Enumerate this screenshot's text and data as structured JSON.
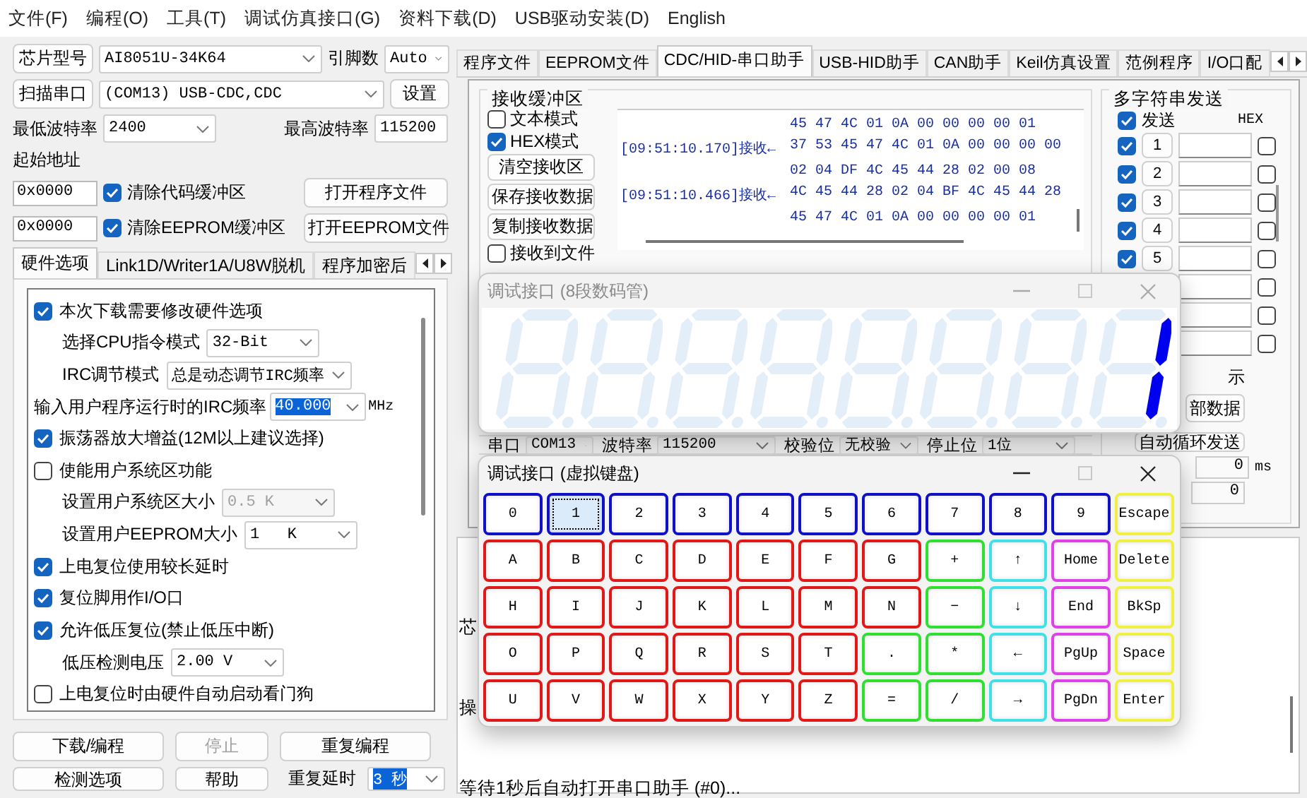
{
  "menu": [
    "文件(F)",
    "编程(O)",
    "工具(T)",
    "调试仿真接口(G)",
    "资料下载(D)",
    "USB驱动安装(D)",
    "English"
  ],
  "left": {
    "chip": {
      "button": "芯片型号",
      "value": "AI8051U-34K64",
      "pins_label": "引脚数",
      "pins": "Auto"
    },
    "port": {
      "button": "扫描串口",
      "value": "(COM13) USB-CDC,CDC",
      "settings": "设置"
    },
    "baud": {
      "min_label": "最低波特率",
      "min": "2400",
      "max_label": "最高波特率",
      "max": "115200"
    },
    "start_address_label": "起始地址",
    "buffers": [
      {
        "address": "0x0000",
        "label": "清除代码缓冲区",
        "checked": true,
        "button": "打开程序文件"
      },
      {
        "address": "0x0000",
        "label": "清除EEPROM缓冲区",
        "checked": true,
        "button": "打开EEPROM文件"
      }
    ],
    "tabs": [
      {
        "label": "硬件选项",
        "selected": true
      },
      {
        "label": "Link1D/Writer1A/U8W脱机",
        "selected": false
      },
      {
        "label": "程序加密后",
        "selected": false
      }
    ],
    "options": [
      {
        "kind": "checkbox",
        "label": "本次下载需要修改硬件选项",
        "checked": true
      },
      {
        "kind": "sub-select",
        "label": "选择CPU指令模式",
        "value": "32-Bit",
        "disabled": false
      },
      {
        "kind": "sub-select",
        "label": "IRC调节模式",
        "value": "总是动态调节IRC频率",
        "disabled": false
      },
      {
        "kind": "input-select",
        "label": "输入用户程序运行时的IRC频率",
        "value": "40.000",
        "unit": "MHz"
      },
      {
        "kind": "checkbox",
        "label": "振荡器放大增益(12M以上建议选择)",
        "checked": true
      },
      {
        "kind": "checkbox",
        "label": "使能用户系统区功能",
        "checked": false
      },
      {
        "kind": "sub-select",
        "label": "设置用户系统区大小",
        "value": "0.5 K",
        "disabled": true
      },
      {
        "kind": "sub-select",
        "label": "设置用户EEPROM大小",
        "value": "1   K",
        "disabled": false
      },
      {
        "kind": "checkbox",
        "label": "上电复位使用较长延时",
        "checked": true
      },
      {
        "kind": "checkbox",
        "label": "复位脚用作I/O口",
        "checked": true
      },
      {
        "kind": "checkbox",
        "label": "允许低压复位(禁止低压中断)",
        "checked": true
      },
      {
        "kind": "sub-select",
        "label": "低压检测电压",
        "value": "2.00 V",
        "disabled": false
      },
      {
        "kind": "checkbox",
        "label": "上电复位时由硬件自动启动看门狗",
        "checked": false
      }
    ],
    "actions": [
      {
        "label": "下载/编程",
        "disabled": false
      },
      {
        "label": "停止",
        "disabled": true
      },
      {
        "label": "重复编程",
        "disabled": false
      }
    ],
    "check_options": "检测选项",
    "help": "帮助",
    "repeat_delay_label": "重复延时",
    "repeat_delay": "3 秒"
  },
  "right": {
    "tabs": [
      {
        "label": "程序文件",
        "selected": false
      },
      {
        "label": "EEPROM文件",
        "selected": false
      },
      {
        "label": "CDC/HID-串口助手",
        "selected": true
      },
      {
        "label": "USB-HID助手",
        "selected": false
      },
      {
        "label": "CAN助手",
        "selected": false
      },
      {
        "label": "Keil仿真设置",
        "selected": false
      },
      {
        "label": "范例程序",
        "selected": false
      },
      {
        "label": "I/O口配",
        "selected": false
      }
    ],
    "receive": {
      "title": "接收缓冲区",
      "modes": [
        {
          "label": "文本模式",
          "checked": false
        },
        {
          "label": "HEX模式",
          "checked": true
        }
      ],
      "buttons": [
        "清空接收区",
        "保存接收数据",
        "复制接收数据"
      ],
      "to_file": {
        "label": "接收到文件",
        "checked": false
      },
      "entries": [
        {
          "lines": [
            "45 47 4C 01 0A 00 00 00 00 01"
          ]
        },
        {
          "stamp": "[09:51:10.170]接收←",
          "lines": [
            "37 53 45 47 4C 01 0A 00 00 00 00",
            "02 04 DF 4C 45 44 28 02 00 08"
          ]
        },
        {
          "stamp": "[09:51:10.466]接收←",
          "lines": [
            "4C 45 44 28 02 04 BF 4C 45 44 28",
            "45 47 4C 01 0A 00 00 00 00 01"
          ]
        }
      ]
    },
    "multi_send": {
      "title": "多字符串发送",
      "send": {
        "label": "发送",
        "checked": true
      },
      "hex_label": "HEX",
      "rows": [
        {
          "number": "1",
          "send": true,
          "hex": false
        },
        {
          "number": "2",
          "send": true,
          "hex": false
        },
        {
          "number": "3",
          "send": true,
          "hex": false
        },
        {
          "number": "4",
          "send": true,
          "hex": false
        },
        {
          "number": "5",
          "send": true,
          "hex": false
        },
        {
          "hex": false
        },
        {
          "hex": false
        },
        {
          "hex": false
        }
      ],
      "partial_label": "示",
      "partial_button": "部数据",
      "auto_button": "自动循环发送",
      "interval": "0",
      "interval_unit": "ms",
      "count": "0"
    },
    "serial": [
      {
        "label": "串口",
        "value": "COM13"
      },
      {
        "label": "波特率",
        "value": "115200"
      },
      {
        "label": "校验位",
        "value": "无校验"
      },
      {
        "label": "停止位",
        "value": "1位"
      }
    ],
    "log": [
      "芯",
      "操",
      "等待1秒后自动打开串口助手 (#0)..."
    ]
  },
  "display_window": {
    "title": "调试接口 (8段数码管)",
    "active": false,
    "digits": [
      {
        "segments": [
          false,
          false,
          false,
          false,
          false,
          false,
          false
        ]
      },
      {
        "segments": [
          false,
          false,
          false,
          false,
          false,
          false,
          false
        ]
      },
      {
        "segments": [
          false,
          false,
          false,
          false,
          false,
          false,
          false
        ]
      },
      {
        "segments": [
          false,
          false,
          false,
          false,
          false,
          false,
          false
        ]
      },
      {
        "segments": [
          false,
          false,
          false,
          false,
          false,
          false,
          false
        ]
      },
      {
        "segments": [
          false,
          false,
          false,
          false,
          false,
          false,
          false
        ]
      },
      {
        "segments": [
          false,
          false,
          false,
          false,
          false,
          false,
          false
        ]
      },
      {
        "segments": [
          false,
          true,
          true,
          false,
          false,
          false,
          false
        ]
      }
    ]
  },
  "keyboard_window": {
    "title": "调试接口 (虚拟键盘)",
    "active": true,
    "keys": [
      {
        "label": "0",
        "color": "#1010c8",
        "selected": false
      },
      {
        "label": "1",
        "color": "#1010c8",
        "selected": true
      },
      {
        "label": "2",
        "color": "#1010c8",
        "selected": false
      },
      {
        "label": "3",
        "color": "#1010c8",
        "selected": false
      },
      {
        "label": "4",
        "color": "#1010c8",
        "selected": false
      },
      {
        "label": "5",
        "color": "#1010c8",
        "selected": false
      },
      {
        "label": "6",
        "color": "#1010c8",
        "selected": false
      },
      {
        "label": "7",
        "color": "#1010c8",
        "selected": false
      },
      {
        "label": "8",
        "color": "#1010c8",
        "selected": false
      },
      {
        "label": "9",
        "color": "#1010c8",
        "selected": false
      },
      {
        "label": "Escape",
        "color": "#f0f040",
        "selected": false
      },
      {
        "label": "A",
        "color": "#e01818",
        "selected": false
      },
      {
        "label": "B",
        "color": "#e01818",
        "selected": false
      },
      {
        "label": "C",
        "color": "#e01818",
        "selected": false
      },
      {
        "label": "D",
        "color": "#e01818",
        "selected": false
      },
      {
        "label": "E",
        "color": "#e01818",
        "selected": false
      },
      {
        "label": "F",
        "color": "#e01818",
        "selected": false
      },
      {
        "label": "G",
        "color": "#e01818",
        "selected": false
      },
      {
        "label": "+",
        "color": "#30e030",
        "selected": false
      },
      {
        "label": "↑",
        "color": "#40e0e8",
        "selected": false
      },
      {
        "label": "Home",
        "color": "#e040e8",
        "selected": false
      },
      {
        "label": "Delete",
        "color": "#f0f040",
        "selected": false
      },
      {
        "label": "H",
        "color": "#e01818",
        "selected": false
      },
      {
        "label": "I",
        "color": "#e01818",
        "selected": false
      },
      {
        "label": "J",
        "color": "#e01818",
        "selected": false
      },
      {
        "label": "K",
        "color": "#e01818",
        "selected": false
      },
      {
        "label": "L",
        "color": "#e01818",
        "selected": false
      },
      {
        "label": "M",
        "color": "#e01818",
        "selected": false
      },
      {
        "label": "N",
        "color": "#e01818",
        "selected": false
      },
      {
        "label": "−",
        "color": "#30e030",
        "selected": false
      },
      {
        "label": "↓",
        "color": "#40e0e8",
        "selected": false
      },
      {
        "label": "End",
        "color": "#e040e8",
        "selected": false
      },
      {
        "label": "BkSp",
        "color": "#f0f040",
        "selected": false
      },
      {
        "label": "O",
        "color": "#e01818",
        "selected": false
      },
      {
        "label": "P",
        "color": "#e01818",
        "selected": false
      },
      {
        "label": "Q",
        "color": "#e01818",
        "selected": false
      },
      {
        "label": "R",
        "color": "#e01818",
        "selected": false
      },
      {
        "label": "S",
        "color": "#e01818",
        "selected": false
      },
      {
        "label": "T",
        "color": "#e01818",
        "selected": false
      },
      {
        "label": ".",
        "color": "#30e030",
        "selected": false
      },
      {
        "label": "*",
        "color": "#30e030",
        "selected": false
      },
      {
        "label": "←",
        "color": "#40e0e8",
        "selected": false
      },
      {
        "label": "PgUp",
        "color": "#e040e8",
        "selected": false
      },
      {
        "label": "Space",
        "color": "#f0f040",
        "selected": false
      },
      {
        "label": "U",
        "color": "#e01818",
        "selected": false
      },
      {
        "label": "V",
        "color": "#e01818",
        "selected": false
      },
      {
        "label": "W",
        "color": "#e01818",
        "selected": false
      },
      {
        "label": "X",
        "color": "#e01818",
        "selected": false
      },
      {
        "label": "Y",
        "color": "#e01818",
        "selected": false
      },
      {
        "label": "Z",
        "color": "#e01818",
        "selected": false
      },
      {
        "label": "=",
        "color": "#30e030",
        "selected": false
      },
      {
        "label": "/",
        "color": "#30e030",
        "selected": false
      },
      {
        "label": "→",
        "color": "#40e0e8",
        "selected": false
      },
      {
        "label": "PgDn",
        "color": "#e040e8",
        "selected": false
      },
      {
        "label": "Enter",
        "color": "#f0f040",
        "selected": false
      }
    ]
  }
}
